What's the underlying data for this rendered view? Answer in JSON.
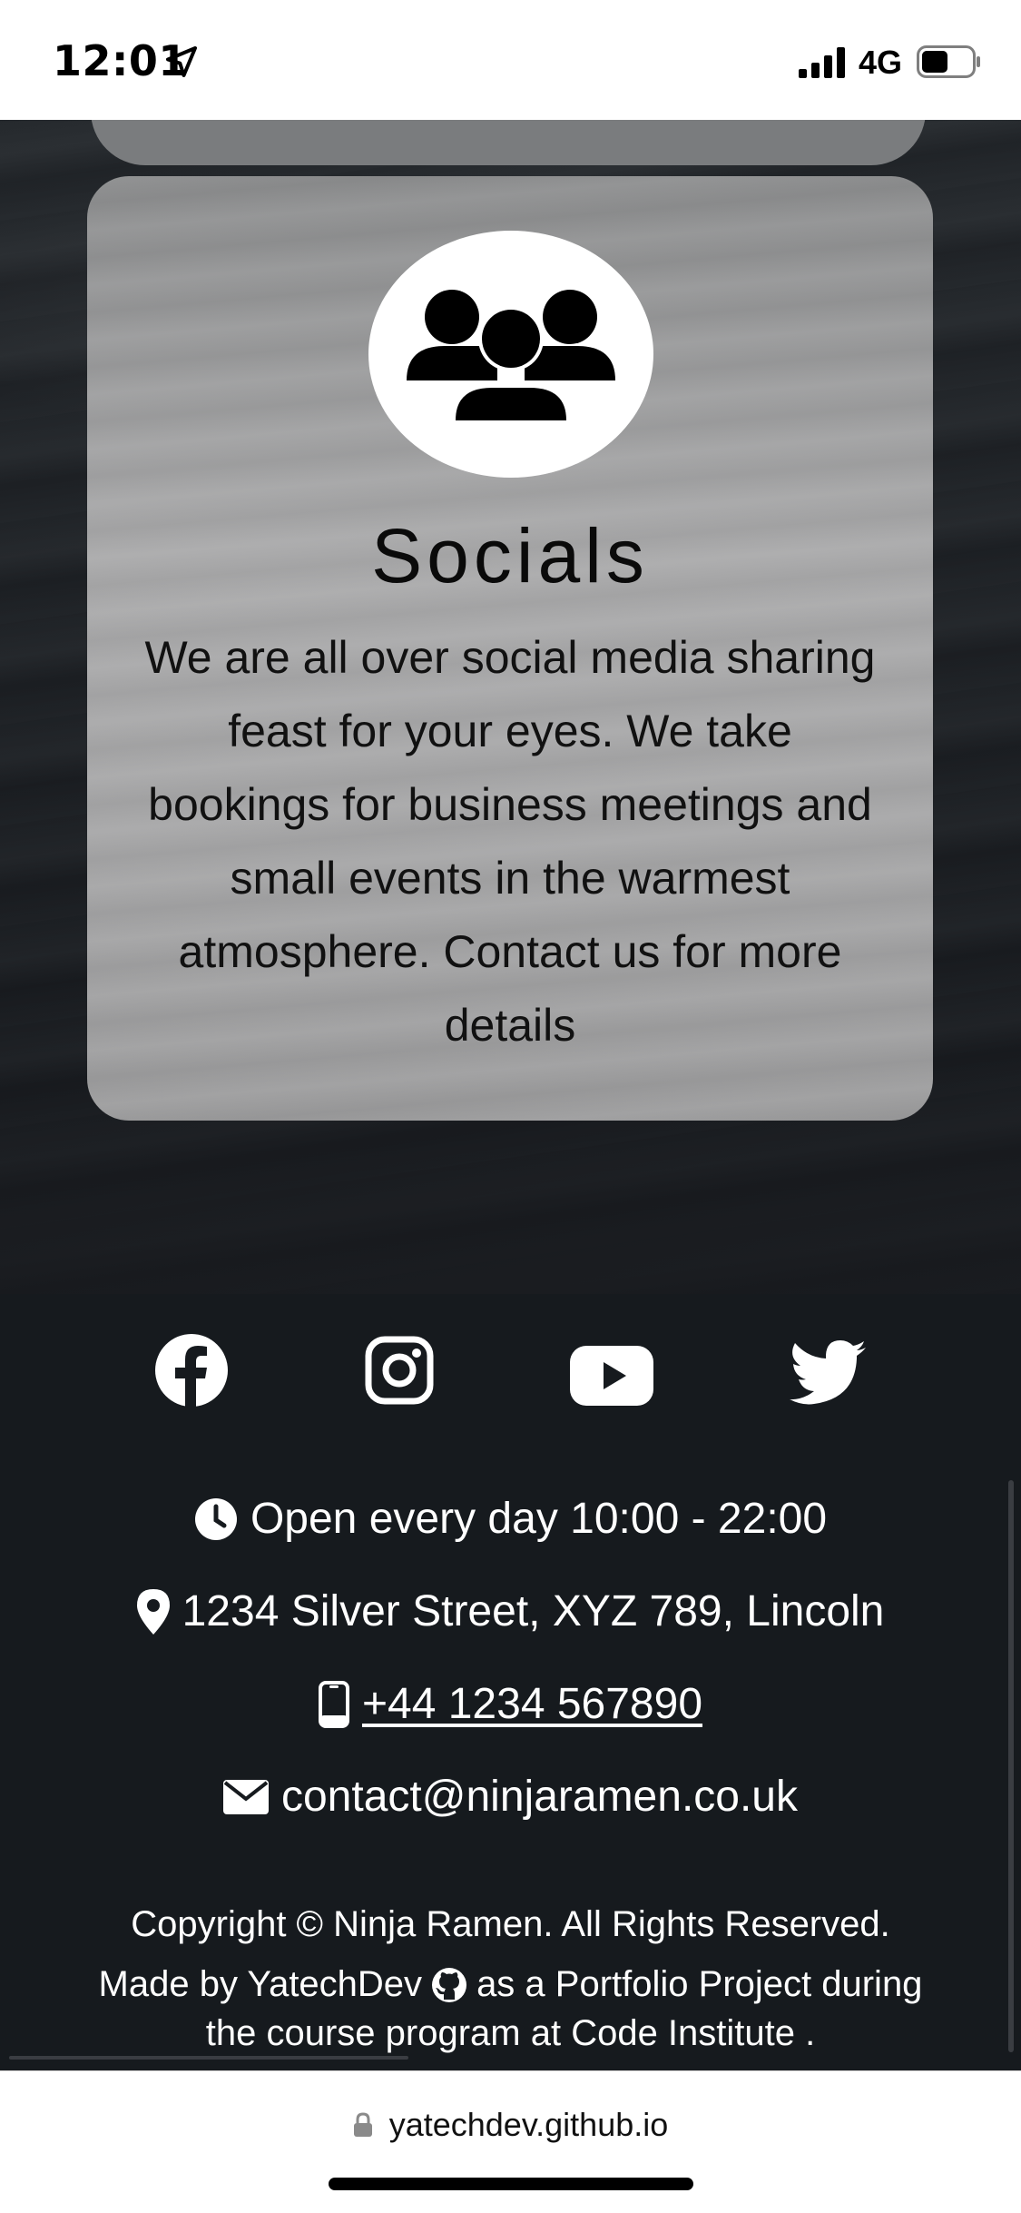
{
  "status_bar": {
    "time": "12:01",
    "network": "4G"
  },
  "card": {
    "title": "Socials",
    "text": "We are all over social media sharing feast for your eyes. We take bookings for business meetings and small events in the warmest atmosphere. Contact us for more details",
    "icon": "users-group-icon"
  },
  "footer": {
    "socials": [
      {
        "name": "facebook-icon"
      },
      {
        "name": "instagram-icon"
      },
      {
        "name": "youtube-icon"
      },
      {
        "name": "twitter-icon"
      }
    ],
    "hours": "Open every day 10:00 - 22:00",
    "address": "1234 Silver Street, XYZ 789, Lincoln",
    "phone": "+44 1234 567890",
    "email": "contact@ninjaramen.co.uk",
    "copyright": "Copyright © Ninja Ramen. All Rights Reserved.",
    "made_by_prefix": "Made by YatechDev",
    "made_by_suffix": "as a Portfolio Project during",
    "made_by_line2": "the course program at Code Institute ."
  },
  "browser": {
    "url": "yatechdev.github.io"
  },
  "colors": {
    "footer_bg": "#161a1e",
    "card_bg": "#a5a5a6",
    "text_light": "#ffffff"
  }
}
